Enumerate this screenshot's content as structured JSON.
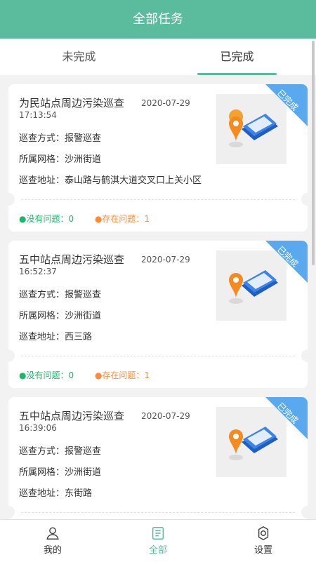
{
  "header": {
    "title": "全部任务"
  },
  "tabs": [
    {
      "label": "未完成"
    },
    {
      "label": "已完成",
      "active": true
    }
  ],
  "cards": [
    {
      "title": "为民站点周边污染巡查",
      "date": "2020-07-29",
      "time": "17:13:54",
      "method_label": "巡查方式：",
      "method": "报警巡查",
      "grid_label": "所属网格：",
      "grid": "沙洲街道",
      "address_label": "巡查地址：",
      "address": "泰山路与鹤淇大道交叉口上关小区",
      "badge": "已完成",
      "ok_text": "●没有问题：0",
      "issue_text": "●存在问题：1"
    },
    {
      "title": "五中站点周边污染巡查",
      "date": "2020-07-29",
      "time": "16:52:37",
      "method_label": "巡查方式：",
      "method": "报警巡查",
      "grid_label": "所属网格：",
      "grid": "沙洲街道",
      "address_label": "巡查地址：",
      "address": "西三路",
      "badge": "已完成",
      "ok_text": "●没有问题：0",
      "issue_text": "●存在问题：1"
    },
    {
      "title": "五中站点周边污染巡查",
      "date": "2020-07-29",
      "time": "16:39:06",
      "method_label": "巡查方式：",
      "method": "报警巡查",
      "grid_label": "所属网格：",
      "grid": "沙洲街道",
      "address_label": "巡查地址：",
      "address": "东街路",
      "badge": "已完成"
    }
  ],
  "bottom_nav": [
    {
      "label": "我的",
      "icon": "user-icon"
    },
    {
      "label": "全部",
      "icon": "list-icon",
      "active": true
    },
    {
      "label": "设置",
      "icon": "gear-icon"
    }
  ],
  "colors": {
    "primary": "#5bbc9d",
    "badge": "#5aa9ef",
    "ok": "#1db76b",
    "issue": "#ff8a3a"
  }
}
